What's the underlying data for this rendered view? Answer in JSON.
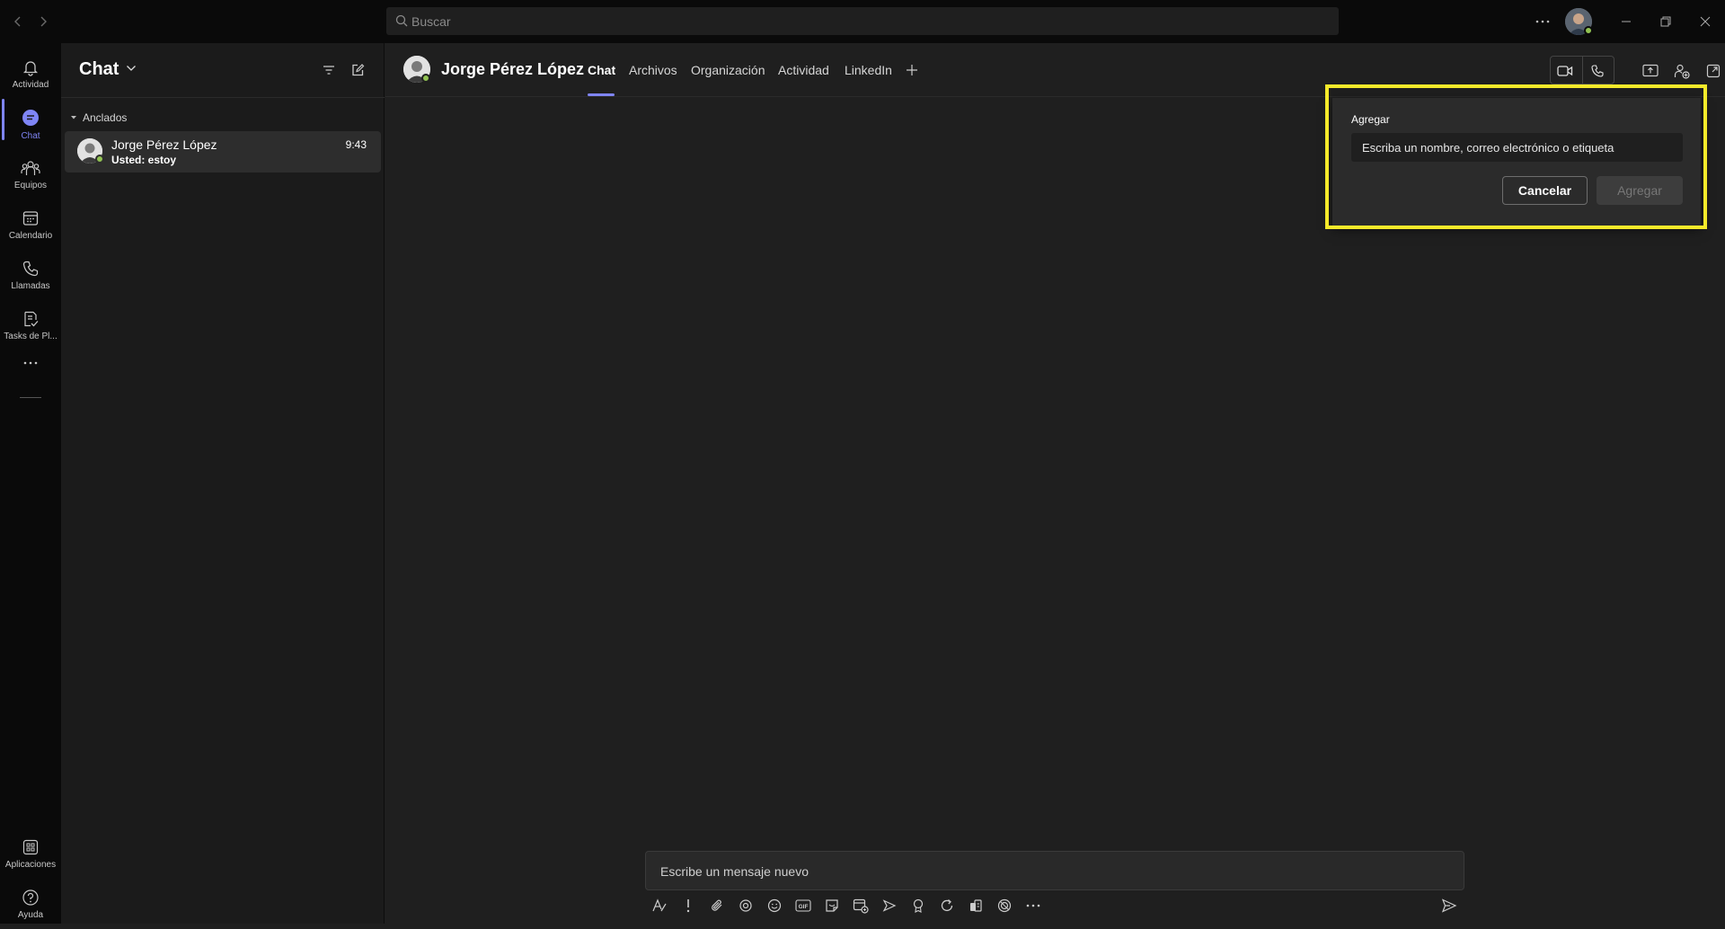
{
  "titlebar": {
    "search_placeholder": "Buscar"
  },
  "rail": {
    "items": [
      {
        "label": "Actividad",
        "icon": "bell-icon"
      },
      {
        "label": "Chat",
        "icon": "chat-icon",
        "active": true
      },
      {
        "label": "Equipos",
        "icon": "teams-icon"
      },
      {
        "label": "Calendario",
        "icon": "calendar-icon"
      },
      {
        "label": "Llamadas",
        "icon": "phone-icon"
      },
      {
        "label": "Tasks de Pl...",
        "icon": "tasks-icon"
      }
    ],
    "bottom": [
      {
        "label": "Aplicaciones",
        "icon": "apps-icon"
      },
      {
        "label": "Ayuda",
        "icon": "help-icon"
      }
    ]
  },
  "list": {
    "title": "Chat",
    "pinned_label": "Anclados",
    "chats": [
      {
        "name": "Jorge Pérez López",
        "preview": "Usted: estoy",
        "time": "9:43"
      }
    ]
  },
  "main": {
    "contact_name": "Jorge Pérez López",
    "tabs": [
      "Chat",
      "Archivos",
      "Organización",
      "Actividad",
      "LinkedIn"
    ],
    "active_tab": "Chat"
  },
  "popup": {
    "label": "Agregar",
    "input_placeholder": "Escriba un nombre, correo electrónico o etiqueta",
    "cancel_label": "Cancelar",
    "add_label": "Agregar"
  },
  "compose": {
    "placeholder": "Escribe un mensaje nuevo"
  },
  "colors": {
    "accent": "#7f85f5",
    "presence": "#92c353",
    "highlight": "#f5ea2a"
  }
}
